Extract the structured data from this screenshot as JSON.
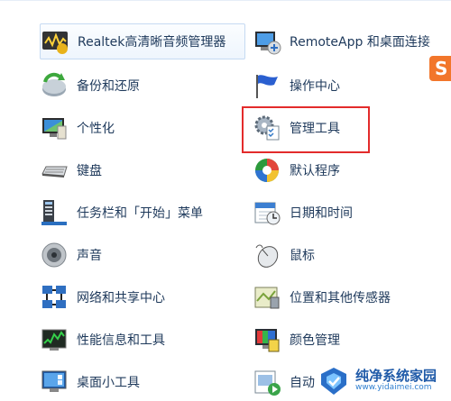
{
  "left_column": [
    {
      "id": "realtek",
      "label": "Realtek高清晰音频管理器",
      "icon": "realtek-audio-icon"
    },
    {
      "id": "backup",
      "label": "备份和还原",
      "icon": "backup-restore-icon"
    },
    {
      "id": "personalize",
      "label": "个性化",
      "icon": "personalization-icon"
    },
    {
      "id": "keyboard",
      "label": "键盘",
      "icon": "keyboard-icon"
    },
    {
      "id": "taskbar",
      "label": "任务栏和「开始」菜单",
      "icon": "taskbar-icon"
    },
    {
      "id": "sound",
      "label": "声音",
      "icon": "speaker-icon"
    },
    {
      "id": "network",
      "label": "网络和共享中心",
      "icon": "network-icon"
    },
    {
      "id": "performance",
      "label": "性能信息和工具",
      "icon": "performance-icon"
    },
    {
      "id": "gadgets",
      "label": "桌面小工具",
      "icon": "desktop-gadgets-icon"
    }
  ],
  "right_column": [
    {
      "id": "remoteapp",
      "label": "RemoteApp 和桌面连接",
      "icon": "remoteapp-icon"
    },
    {
      "id": "action",
      "label": "操作中心",
      "icon": "action-center-flag-icon"
    },
    {
      "id": "admin",
      "label": "管理工具",
      "icon": "admin-tools-icon"
    },
    {
      "id": "defaults",
      "label": "默认程序",
      "icon": "default-programs-icon"
    },
    {
      "id": "datetime",
      "label": "日期和时间",
      "icon": "calendar-clock-icon"
    },
    {
      "id": "mouse",
      "label": "鼠标",
      "icon": "mouse-icon"
    },
    {
      "id": "location",
      "label": "位置和其他传感器",
      "icon": "location-sensors-icon"
    },
    {
      "id": "color",
      "label": "颜色管理",
      "icon": "color-management-icon"
    },
    {
      "id": "autoplay",
      "label": "自动",
      "icon": "autoplay-icon"
    }
  ],
  "corner_badge": "S",
  "watermark": {
    "title": "纯净系统家园",
    "url": "www.yidaimei.com"
  },
  "colors": {
    "label": "#1e395b",
    "highlight": "#e32b2b",
    "hover_border": "#c5daf2"
  }
}
